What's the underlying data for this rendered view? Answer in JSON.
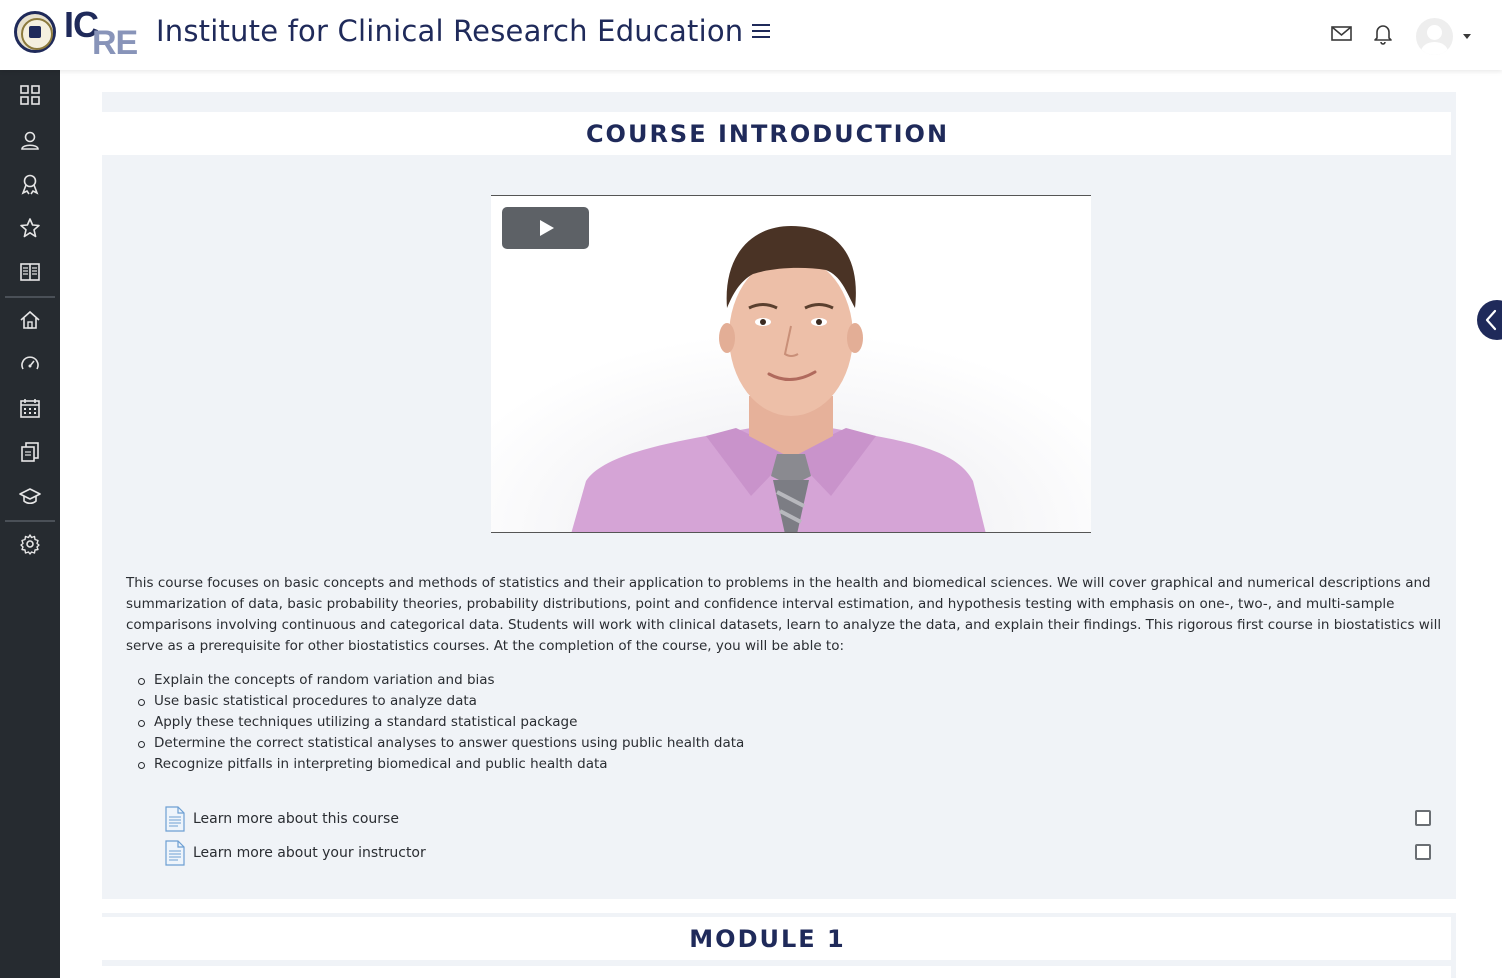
{
  "header": {
    "logo_text_top": "IC",
    "logo_text_bottom": "RE",
    "site_title": "Institute for Clinical Research Education"
  },
  "icons": {
    "menu": "hamburger-icon",
    "messages": "envelope-icon",
    "notifications": "bell-icon",
    "user": "avatar-placeholder",
    "rail": [
      "dashboard-grid-icon",
      "users-icon",
      "badge-award-icon",
      "star-icon",
      "book-icon",
      "home-icon",
      "gauge-icon",
      "calendar-icon",
      "files-icon",
      "graduation-cap-icon",
      "gear-icon"
    ]
  },
  "course_intro": {
    "title": "COURSE INTRODUCTION",
    "description": "This course focuses on basic concepts and methods of statistics and their application to problems in the health and biomedical sciences. We will cover graphical and numerical descriptions and summarization of data, basic probability theories, probability distributions, point and confidence interval estimation, and hypothesis testing with emphasis on one-, two-, and multi-sample comparisons involving continuous and categorical data. Students will work with clinical datasets, learn to analyze the data, and explain their findings. This rigorous first course in biostatistics will serve as a prerequisite for other biostatistics courses. At the completion of the course, you will be able to:",
    "objectives": [
      "Explain the concepts of random variation and bias",
      "Use basic statistical procedures to analyze data",
      "Apply these techniques utilizing a standard statistical package",
      "Determine the correct statistical analyses to answer questions using public health data",
      "Recognize pitfalls in interpreting biomedical and public health data"
    ],
    "activities": [
      {
        "label": "Learn more about this course",
        "completed": false
      },
      {
        "label": "Learn more about your instructor",
        "completed": false
      }
    ]
  },
  "module": {
    "title": "MODULE 1"
  },
  "colors": {
    "brand_navy": "#1f2a5a",
    "rail_bg": "#262b30",
    "section_bg": "#f0f3f7",
    "logo_accent": "#8894b9",
    "shirt": "#d5a4d6"
  }
}
